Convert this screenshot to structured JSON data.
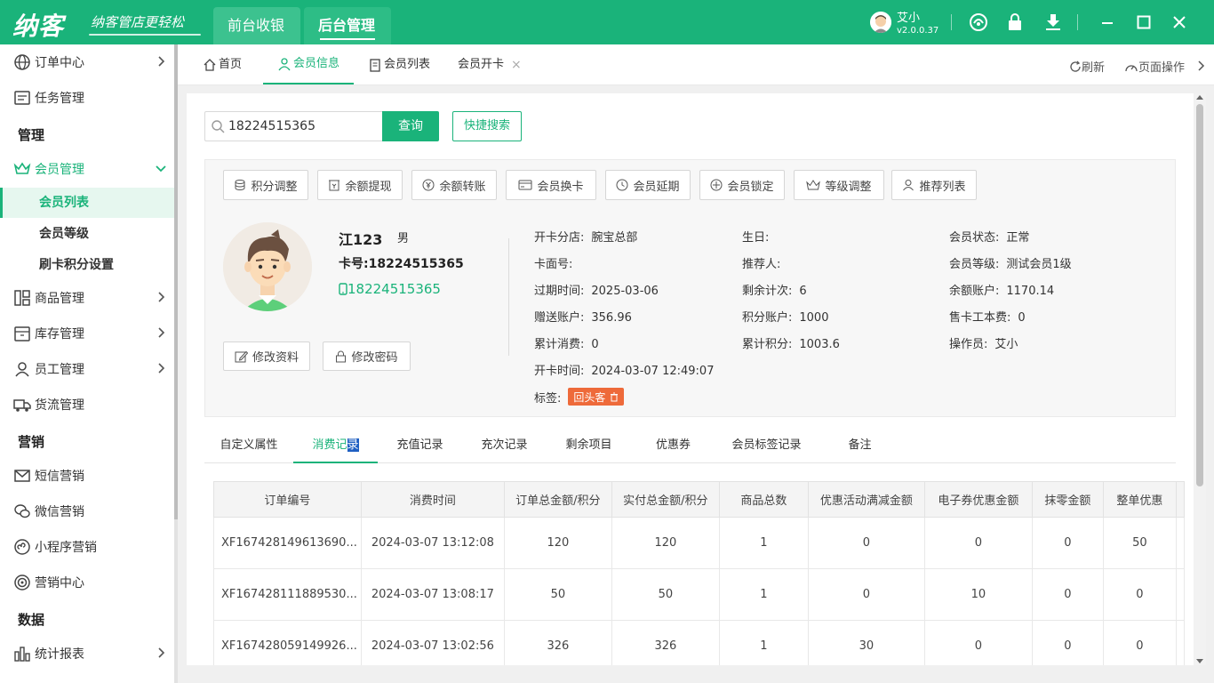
{
  "app": {
    "logo": "纳客",
    "slogan": "纳客管店更轻松",
    "top_tabs": [
      "前台收银",
      "后台管理"
    ],
    "user": {
      "name": "艾小",
      "version": "v2.0.0.37"
    }
  },
  "sidebar": {
    "order_center": "订单中心",
    "task_mgmt": "任务管理",
    "section_manage": "管理",
    "member_mgmt": "会员管理",
    "member_list": "会员列表",
    "member_level": "会员等级",
    "card_points": "刷卡积分设置",
    "goods_mgmt": "商品管理",
    "stock_mgmt": "库存管理",
    "staff_mgmt": "员工管理",
    "logistics_mgmt": "货流管理",
    "section_marketing": "营销",
    "sms_marketing": "短信营销",
    "wechat_marketing": "微信营销",
    "miniapp_marketing": "小程序营销",
    "marketing_center": "营销中心",
    "section_data": "数据",
    "stat_report": "统计报表"
  },
  "page_tabs": {
    "home": "首页",
    "member_info": "会员信息",
    "member_list": "会员列表",
    "member_open_card": "会员开卡",
    "refresh": "刷新",
    "page_ops": "页面操作"
  },
  "search": {
    "value": "18224515365",
    "query_btn": "查询",
    "quick_btn": "快捷搜索"
  },
  "actions": [
    "积分调整",
    "余额提现",
    "余额转账",
    "会员换卡",
    "会员延期",
    "会员锁定",
    "等级调整",
    "推荐列表"
  ],
  "member": {
    "name": "江123",
    "sex": "男",
    "card_label": "卡号:",
    "card_no": "18224515365",
    "phone": "18224515365",
    "edit_profile": "修改资料",
    "edit_password": "修改密码",
    "tag": "回头客"
  },
  "info": {
    "col1": [
      {
        "k": "开卡分店:",
        "v": "腕宝总部"
      },
      {
        "k": "卡面号:",
        "v": ""
      },
      {
        "k": "过期时间:",
        "v": "2025-03-06"
      },
      {
        "k": "赠送账户:",
        "v": "356.96"
      },
      {
        "k": "累计消费:",
        "v": "0"
      },
      {
        "k": "开卡时间:",
        "v": "2024-03-07 12:49:07"
      },
      {
        "k": "标签:",
        "v": ""
      }
    ],
    "col2": [
      {
        "k": "生日:",
        "v": ""
      },
      {
        "k": "推荐人:",
        "v": ""
      },
      {
        "k": "剩余计次:",
        "v": "6"
      },
      {
        "k": "积分账户:",
        "v": "1000"
      },
      {
        "k": "累计积分:",
        "v": "1003.6"
      }
    ],
    "col3": [
      {
        "k": "会员状态:",
        "v": "正常"
      },
      {
        "k": "会员等级:",
        "v": "测试会员1级"
      },
      {
        "k": "余额账户:",
        "v": "1170.14"
      },
      {
        "k": "售卡工本费:",
        "v": "0"
      },
      {
        "k": "操作员:",
        "v": "艾小"
      }
    ]
  },
  "sub_tabs": [
    "自定义属性",
    "消费记",
    "录",
    "充值记录",
    "充次记录",
    "剩余项目",
    "优惠券",
    "会员标签记录",
    "备注"
  ],
  "table": {
    "headers": [
      "订单编号",
      "消费时间",
      "订单总金额/积分",
      "实付总金额/积分",
      "商品总数",
      "优惠活动满减金额",
      "电子券优惠金额",
      "抹零金额",
      "整单优惠"
    ],
    "rows": [
      [
        "XF167428149613690...",
        "2024-03-07 13:12:08",
        "120",
        "120",
        "1",
        "0",
        "0",
        "0",
        "50"
      ],
      [
        "XF167428111889530...",
        "2024-03-07 13:08:17",
        "50",
        "50",
        "1",
        "0",
        "10",
        "0",
        "0"
      ],
      [
        "XF167428059149926...",
        "2024-03-07 13:02:56",
        "326",
        "326",
        "1",
        "30",
        "0",
        "0",
        "0"
      ]
    ]
  },
  "colors": {
    "brand": "#1ab37a",
    "tag": "#ee6a3a"
  }
}
